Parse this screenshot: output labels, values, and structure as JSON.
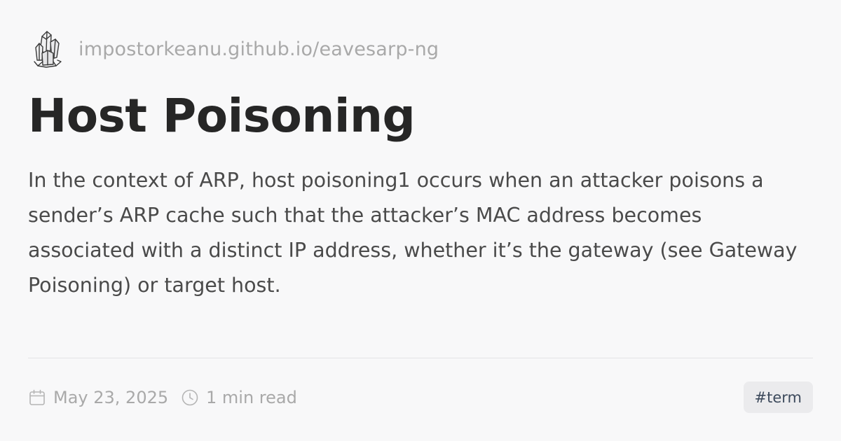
{
  "site": {
    "logo_icon": "crystal-cluster-icon",
    "url": "impostorkeanu.github.io/eavesarp-ng"
  },
  "article": {
    "title": "Host Poisoning",
    "description": "In the context of ARP, host poisoning1 occurs when an attacker poisons a sender’s ARP cache such that the attacker’s MAC address becomes associated with a distinct IP address, whether it’s the gateway (see Gateway Poisoning) or target host."
  },
  "meta": {
    "date_icon": "calendar-icon",
    "date": "May 23, 2025",
    "read_time_icon": "clock-icon",
    "read_time": "1 min read",
    "tag": "#term"
  },
  "colors": {
    "background": "#f8f8f9",
    "title": "#262626",
    "body_text": "#4a4a4a",
    "muted_text": "#a9a9a9",
    "tag_background": "#ebebed",
    "tag_text": "#3d4a5c"
  }
}
